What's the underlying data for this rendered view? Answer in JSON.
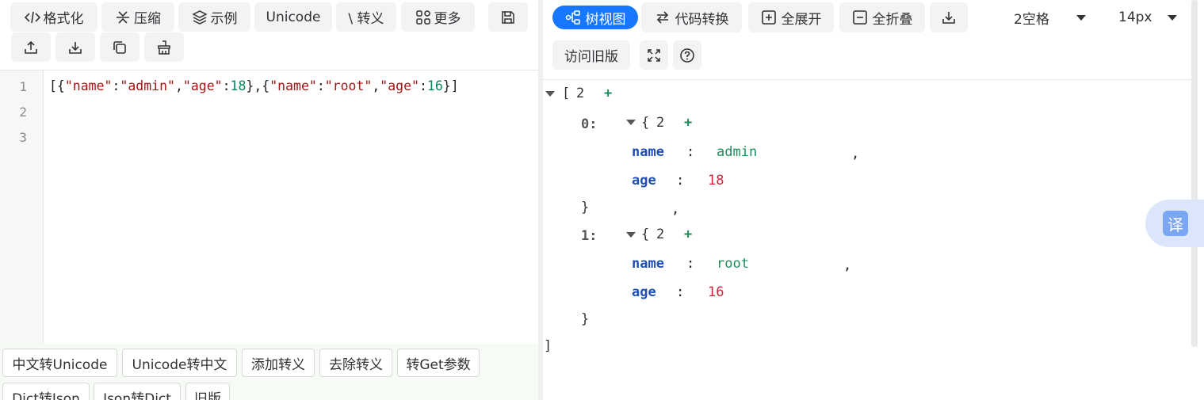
{
  "toolbar": {
    "format": "格式化",
    "compress": "压缩",
    "example": "示例",
    "unicode": "Unicode",
    "escape": "\\ 转义",
    "more": "更多"
  },
  "editor": {
    "line_numbers": [
      "1",
      "2",
      "3"
    ],
    "tokens": {
      "open": "[{",
      "k_name": "\"name\"",
      "colon": ":",
      "v_admin": "\"admin\"",
      "comma": ",",
      "k_age": "\"age\"",
      "v_18": "18",
      "mid": "},{",
      "v_root": "\"root\"",
      "v_16": "16",
      "close": "}]"
    }
  },
  "bottom_buttons": [
    "中文转Unicode",
    "Unicode转中文",
    "添加转义",
    "去除转义",
    "转Get参数",
    "Dict转Json",
    "Json转Dict",
    "旧版"
  ],
  "right_toolbar": {
    "tree_view": "树视图",
    "code_convert": "代码转换",
    "expand_all": "全展开",
    "collapse_all": "全折叠",
    "indent_select": "2空格",
    "font_size_select": "14px",
    "old_version": "访问旧版"
  },
  "tree": {
    "root_open": "[",
    "root_count": "2",
    "plus": "+",
    "item0_index": "0:",
    "item1_index": "1:",
    "obj_open": "{",
    "obj_count": "2",
    "key_name": "name",
    "key_age": "age",
    "sep": ":",
    "val_admin": "admin",
    "val_18": "18",
    "val_root": "root",
    "val_16": "16",
    "comma": ",",
    "obj_close": "}",
    "root_close": "]"
  },
  "translate_widget": "译",
  "colors": {
    "active_blue": "#1677ff",
    "key_blue": "#1f4fb3",
    "string_green": "#1e8c5a",
    "number_red": "#d0253a"
  }
}
